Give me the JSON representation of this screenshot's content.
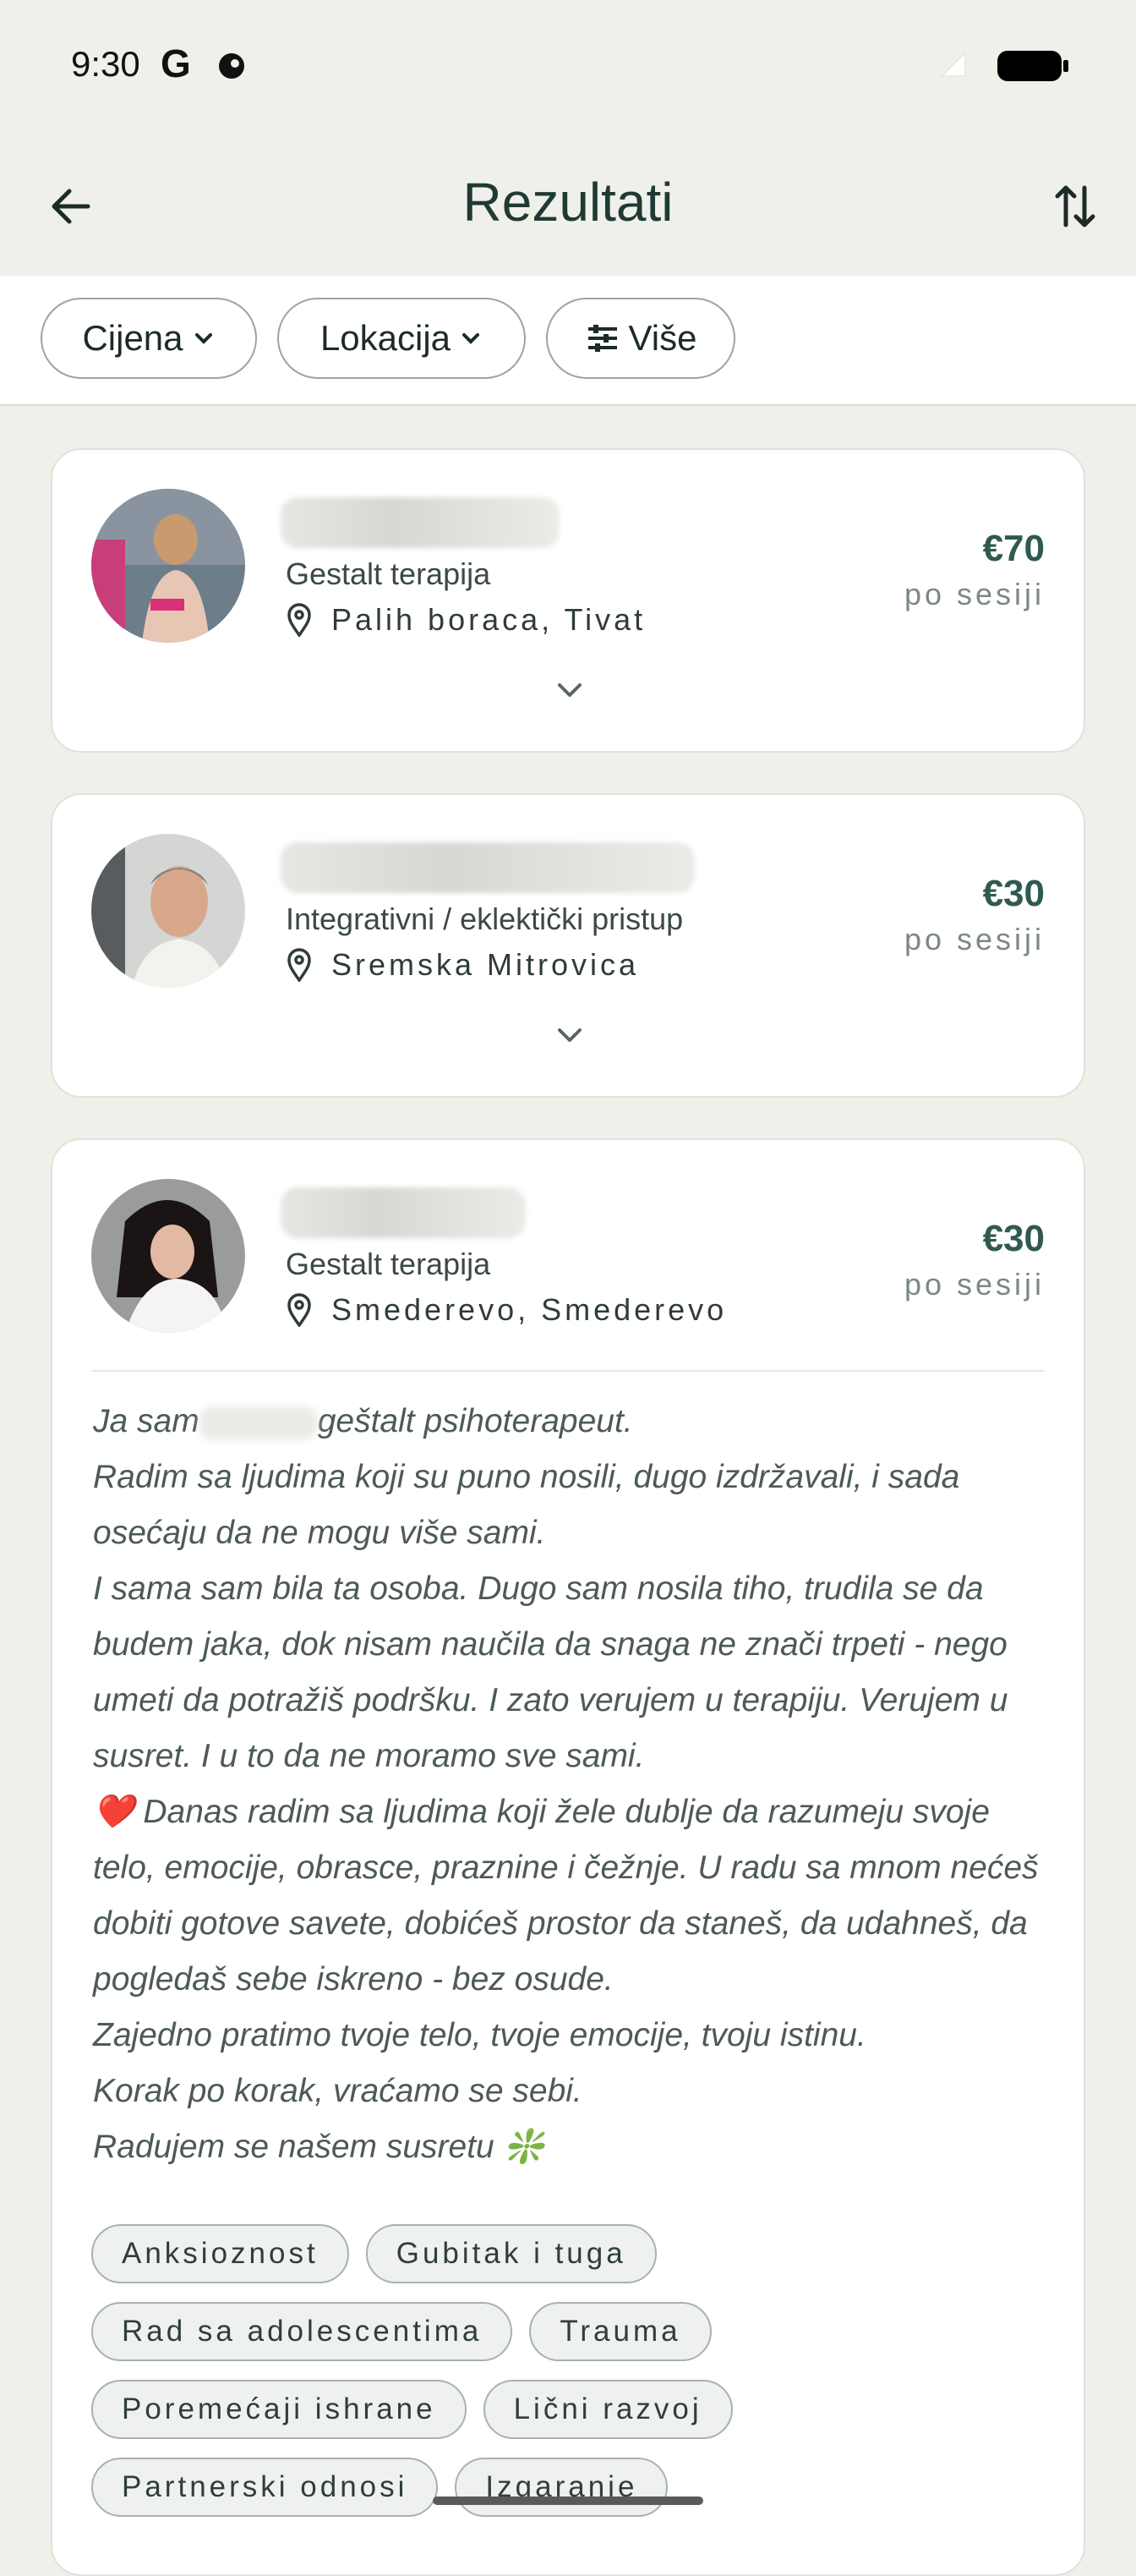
{
  "status_bar": {
    "time": "9:30",
    "g_logo": "G"
  },
  "app_bar": {
    "title": "Rezultati",
    "back_icon": "arrow-left-icon",
    "sort_icon": "sort-arrows-icon"
  },
  "filters": [
    {
      "label": "Cijena",
      "icon": "chevron-down-icon"
    },
    {
      "label": "Lokacija",
      "icon": "chevron-down-icon"
    },
    {
      "label": "Više",
      "icon": "tune-icon"
    }
  ],
  "cards": [
    {
      "approach": "Gestalt terapija",
      "location": "Palih boraca, Tivat",
      "price": "€70",
      "per_session": "po sesiji"
    },
    {
      "approach": "Integrativni / eklektički pristup",
      "location": "Sremska Mitrovica",
      "price": "€30",
      "per_session": "po sesiji"
    },
    {
      "approach": "Gestalt terapija",
      "location": "Smederevo, Smederevo",
      "price": "€30",
      "per_session": "po sesiji",
      "bio_lines": {
        "l1a": "Ja sam",
        "l1b": "geštalt psihoterapeut.",
        "l2": "Radim sa ljudima koji su puno nosili, dugo izdržavali, i sada osećaju da ne mogu više sami.",
        "l3": "I sama sam bila ta osoba. Dugo sam nosila tiho, trudila se da budem jaka, dok nisam naučila da snaga ne znači trpeti - nego umeti da potražiš podršku. I zato verujem u terapiju. Verujem u susret. I u to da ne moramo sve sami.",
        "l4": "❤️ Danas radim sa ljudima koji žele dublje da razumeju svoje telo, emocije, obrasce, praznine i čežnje. U radu sa mnom nećeš dobiti gotove savete, dobićeš prostor da staneš, da udahneš, da pogledaš sebe iskreno - bez osude.",
        "l5": "Zajedno pratimo tvoje telo, tvoje emocije, tvoju istinu.",
        "l6": "Korak po korak, vraćamo se sebi.",
        "l7": "Radujem se našem susretu ❇️"
      },
      "tags": [
        "Anksioznost",
        "Gubitak i tuga",
        "Rad sa adolescentima",
        "Trauma",
        "Poremećaji ishrane",
        "Lični razvoj",
        "Partnerski odnosi",
        "Izgaranje"
      ]
    }
  ]
}
